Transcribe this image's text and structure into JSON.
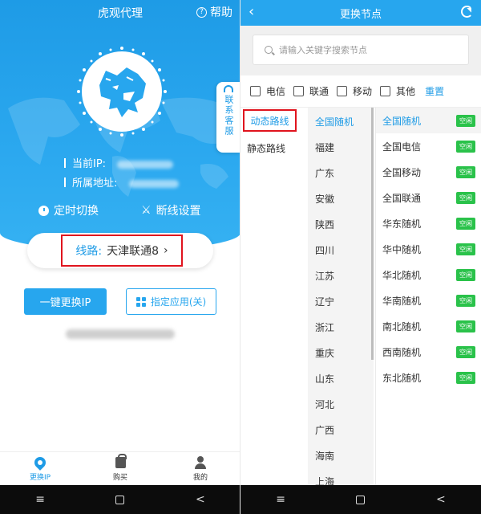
{
  "left": {
    "title": "虎观代理",
    "help_label": "帮助",
    "current_ip_label": "当前IP:",
    "location_label": "所属地址:",
    "timer_switch": "定时切换",
    "reconnect_setting": "断线设置",
    "line_label": "线路:",
    "line_value": "天津联通8",
    "change_ip_button": "一键更换IP",
    "app_button": "指定应用(关)",
    "customer_service": "联系客服",
    "tabs": [
      {
        "label": "更换IP",
        "icon": "location-pin-icon"
      },
      {
        "label": "购买",
        "icon": "shopping-bag-icon"
      },
      {
        "label": "我的",
        "icon": "user-icon"
      }
    ],
    "colors": {
      "primary": "#27a6ee",
      "highlight": "#e0141e"
    }
  },
  "right": {
    "title": "更换节点",
    "search_placeholder": "请输入关键字搜索节点",
    "filters": [
      "电信",
      "联通",
      "移动",
      "其他"
    ],
    "reset_label": "重置",
    "route_types": [
      "动态路线",
      "静态路线"
    ],
    "provinces": [
      "全国随机",
      "福建",
      "广东",
      "安徽",
      "陕西",
      "四川",
      "江苏",
      "辽宁",
      "浙江",
      "重庆",
      "山东",
      "河北",
      "广西",
      "海南",
      "上海"
    ],
    "nodes": [
      {
        "name": "全国随机",
        "status": "空闲"
      },
      {
        "name": "全国电信",
        "status": "空闲"
      },
      {
        "name": "全国移动",
        "status": "空闲"
      },
      {
        "name": "全国联通",
        "status": "空闲"
      },
      {
        "name": "华东随机",
        "status": "空闲"
      },
      {
        "name": "华中随机",
        "status": "空闲"
      },
      {
        "name": "华北随机",
        "status": "空闲"
      },
      {
        "name": "华南随机",
        "status": "空闲"
      },
      {
        "name": "南北随机",
        "status": "空闲"
      },
      {
        "name": "西南随机",
        "status": "空闲"
      },
      {
        "name": "东北随机",
        "status": "空闲"
      }
    ],
    "colors": {
      "status_badge": "#2ac24a"
    }
  },
  "system_nav": {
    "menu_glyph": "≡",
    "back_glyph": "<"
  }
}
